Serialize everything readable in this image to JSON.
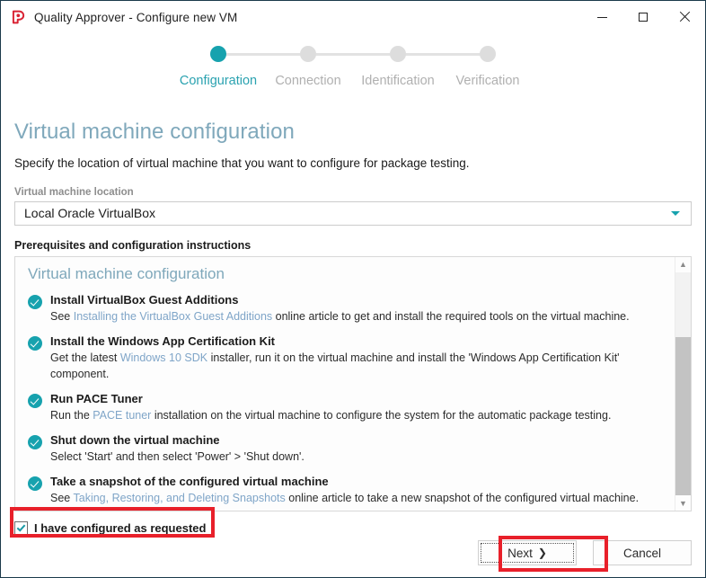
{
  "window": {
    "title": "Quality Approver - Configure new VM",
    "app_icon": "quality-approver-logo",
    "controls": {
      "minimize": "minimize-icon",
      "maximize": "maximize-icon",
      "close": "close-icon"
    }
  },
  "stepper": {
    "steps": [
      {
        "label": "Configuration",
        "state": "active"
      },
      {
        "label": "Connection",
        "state": "pending"
      },
      {
        "label": "Identification",
        "state": "pending"
      },
      {
        "label": "Verification",
        "state": "pending"
      }
    ],
    "active_color": "#17a2ae",
    "pending_color": "#dddddd"
  },
  "page": {
    "title": "Virtual machine configuration",
    "subtitle": "Specify the location of virtual machine that you want to configure for package testing.",
    "title_color": "#7fa8bb"
  },
  "location_field": {
    "label": "Virtual machine location",
    "value": "Local Oracle VirtualBox",
    "chevron": "chevron-down-icon"
  },
  "instructions_section": {
    "label": "Prerequisites and configuration instructions",
    "panel_title": "Virtual machine configuration",
    "items": [
      {
        "icon": "check-circle-icon",
        "title": "Install VirtualBox Guest Additions",
        "desc_before": "See ",
        "link": "Installing the VirtualBox Guest Additions",
        "desc_after": " online article to get and install the required tools on the virtual machine."
      },
      {
        "icon": "check-circle-icon",
        "title": "Install the Windows App Certification Kit",
        "desc_before": "Get the latest ",
        "link": "Windows 10 SDK",
        "desc_after": " installer, run it on the virtual machine and install the 'Windows App Certification Kit' component."
      },
      {
        "icon": "check-circle-icon",
        "title": "Run PACE Tuner",
        "desc_before": "Run the ",
        "link": "PACE tuner",
        "desc_after": " installation on the virtual machine to configure the system for the automatic package testing."
      },
      {
        "icon": "check-circle-icon",
        "title": "Shut down the virtual machine",
        "desc_before": "Select 'Start' and then select 'Power' > 'Shut down'.",
        "link": "",
        "desc_after": ""
      },
      {
        "icon": "check-circle-icon",
        "title": "Take a snapshot of the configured virtual machine",
        "desc_before": "See ",
        "link": "Taking, Restoring, and Deleting Snapshots",
        "desc_after": " online article to take a new snapshot of the configured virtual machine."
      }
    ],
    "scrollbar": {
      "up_arrow": "chevron-up-icon",
      "down_arrow": "chevron-down-icon"
    }
  },
  "confirm": {
    "label": "I have configured as requested",
    "checked": true
  },
  "footer": {
    "next_label": "Next",
    "next_chevron": "chevron-right-icon",
    "cancel_label": "Cancel"
  },
  "annotations": {
    "color": "#e8202a",
    "boxes": [
      "confirm-checkbox-highlight",
      "next-button-highlight"
    ]
  }
}
